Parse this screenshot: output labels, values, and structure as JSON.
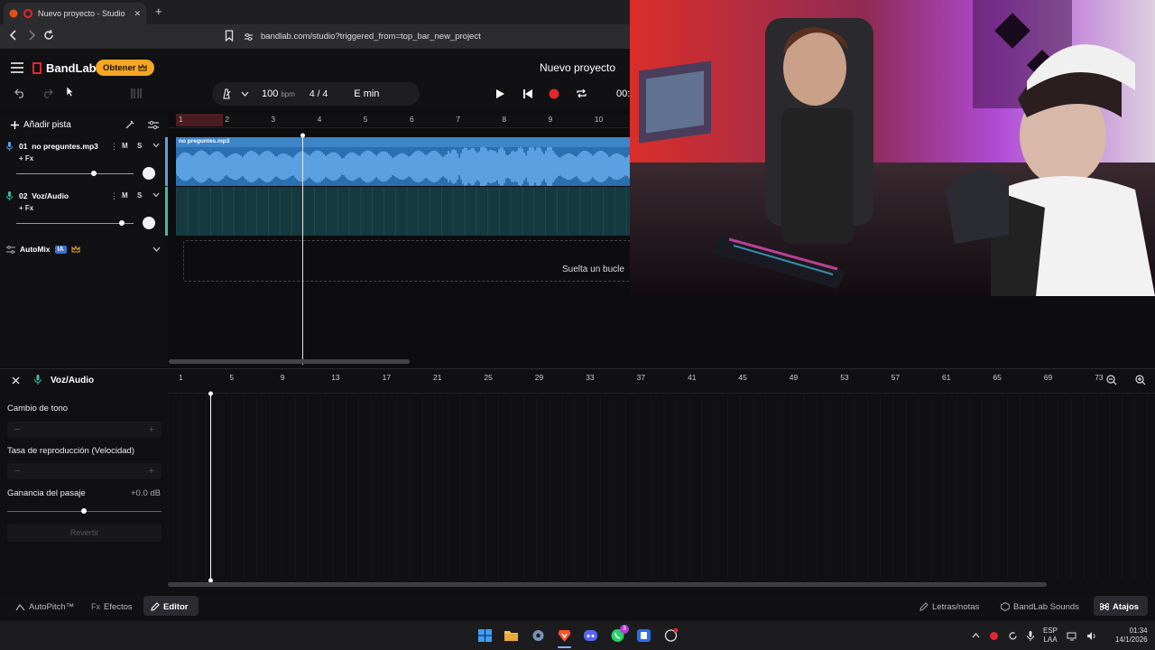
{
  "browser": {
    "tab_title": "Nuevo proyecto - Studio",
    "tab_close": "✕",
    "new_tab": "+",
    "url": "bandlab.com/studio?triggered_from=top_bar_new_project"
  },
  "header": {
    "logo_text": "BandLab",
    "get_button": "Obtener",
    "project_title": "Nuevo proyecto"
  },
  "transport": {
    "bpm_value": "100",
    "bpm_unit": "bpm",
    "time_signature": "4 / 4",
    "key": "E min",
    "time_display": "00:"
  },
  "tracks_panel": {
    "add_track": "Añadir pista",
    "tracks": [
      {
        "number": "01",
        "name": "no preguntes.mp3",
        "mute": "M",
        "solo": "S",
        "fx": "+ Fx",
        "volume": 0.66
      },
      {
        "number": "02",
        "name": "Voz/Audio",
        "mute": "M",
        "solo": "S",
        "fx": "+ Fx",
        "volume": 0.9
      }
    ],
    "automix_label": "AutoMix",
    "automix_badge": "IA"
  },
  "timeline": {
    "ruler": [
      "1",
      "2",
      "3",
      "4",
      "5",
      "6",
      "7",
      "8",
      "9",
      "10"
    ],
    "region_name": "no preguntes.mp3",
    "drop_zone_text": "Suelta un bucle"
  },
  "editor": {
    "track_name": "Voz/Audio",
    "ruler": [
      "1",
      "5",
      "9",
      "13",
      "17",
      "21",
      "25",
      "29",
      "33",
      "37",
      "41",
      "45",
      "49",
      "53",
      "57",
      "61",
      "65",
      "69",
      "73"
    ],
    "pitch_label": "Cambio de tono",
    "rate_label": "Tasa de reproducción (Velocidad)",
    "gain_label": "Ganancia del pasaje",
    "gain_value": "+0.0 dB",
    "stepper_minus": "−",
    "stepper_plus": "+",
    "revert_button": "Revertir"
  },
  "bottom_bar": {
    "autopitch": "AutoPitch™",
    "effects_icon": "Fx",
    "effects": "Efectos",
    "editor": "Editor",
    "lyrics": "Letras/notas",
    "sounds": "BandLab Sounds",
    "shortcuts": "Atajos"
  },
  "taskbar": {
    "whatsapp_badge": "3",
    "lang_top": "ESP",
    "lang_bottom": "LAA",
    "time": "01:34",
    "date": "14/1/2026"
  },
  "colors": {
    "accent_orange": "#f5a623",
    "record_red": "#e0282e",
    "track1_region": "#2a6fb0",
    "track2_region": "#15393f",
    "automix_badge": "#3d6fd1"
  }
}
